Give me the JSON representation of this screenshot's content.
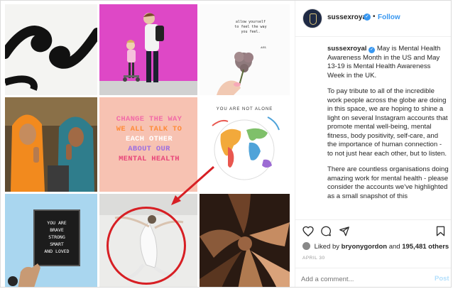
{
  "grid": {
    "quote_text": "allow yourself\nto feel the way\nyou feel.",
    "quote_signature": "ᴀʙʟ",
    "change_lines": [
      "CHANGE THE WAY",
      "WE ALL TALK TO",
      "EACH OTHER",
      "ABOUT OUR",
      "MENTAL HEALTH"
    ],
    "not_alone_text": "YOU ARE NOT ALONE",
    "board_text": "YOU ARE\nBRAVE\nSTRONG\nSMART\nAND LOVED"
  },
  "post": {
    "username": "sussexroyal",
    "follow_label": "Follow",
    "caption_lead": "May is Mental Health Awareness Month in the US and May 13-19 is Mental Health Awareness Week in the UK.",
    "paragraph_1": "To pay tribute to all of the incredible work people across the globe are doing in this space, we are hoping to shine a light on several Instagram accounts that promote mental well-being, mental fitness, body positivity, self-care, and the importance of human connection - to not just hear each other, but to listen.",
    "paragraph_2": "There are countless organisations doing amazing work for mental health - please consider the accounts we've highlighted as a small snapshot of this",
    "liked_prefix": "Liked by",
    "liked_user": "bryonygordon",
    "liked_and": "and",
    "liked_count": "195,481 others",
    "date": "APRIL 30",
    "comment_placeholder": "Add a comment...",
    "post_label": "Post"
  },
  "colors": {
    "accent": "#3897f0",
    "annotation_red": "#d71f24",
    "post_disabled": "#b2dffc"
  },
  "icons": [
    "heart-icon",
    "comment-icon",
    "share-icon",
    "save-icon",
    "verified-badge-icon"
  ]
}
